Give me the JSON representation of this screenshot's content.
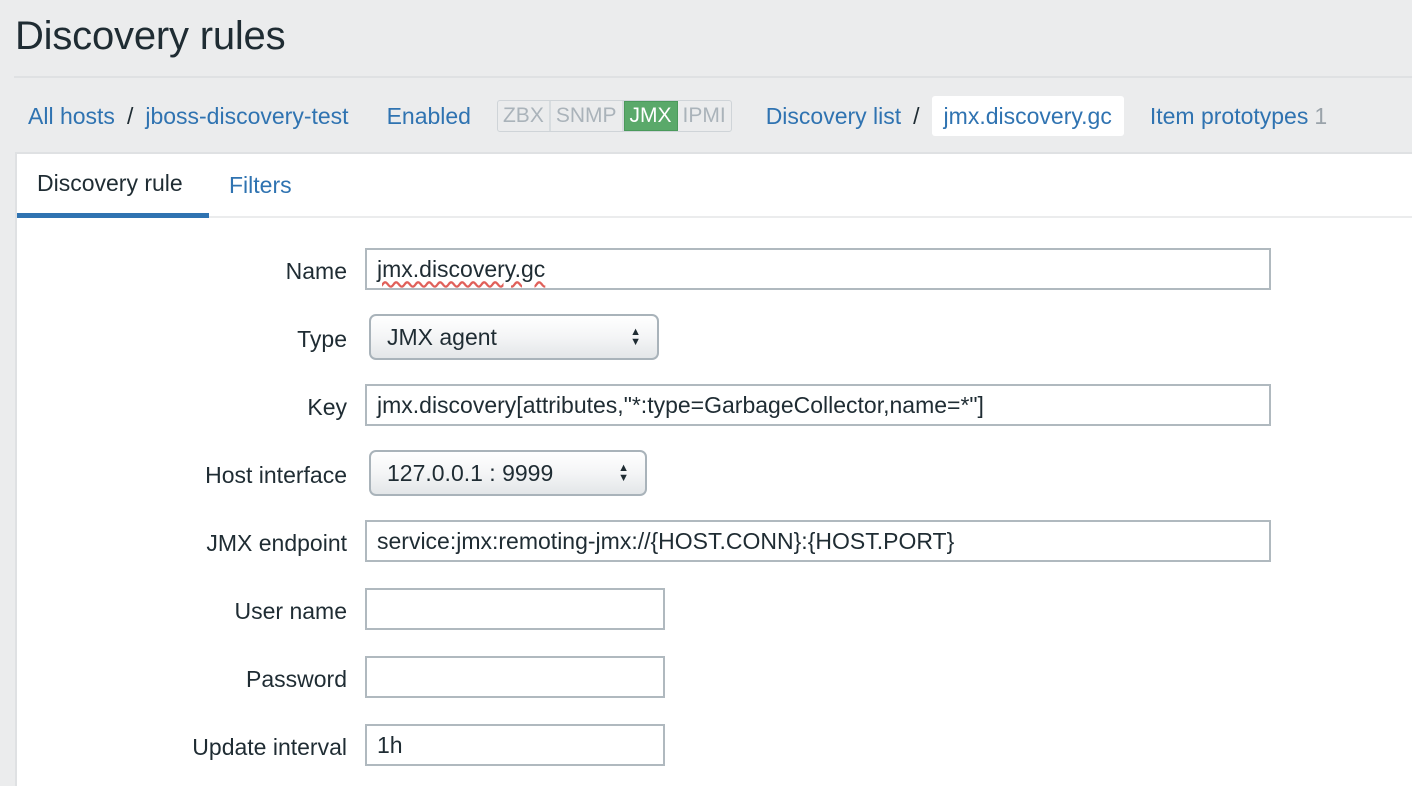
{
  "page": {
    "title": "Discovery rules"
  },
  "nav": {
    "all_hosts": "All hosts",
    "separator": "/",
    "host": "jboss-discovery-test",
    "status": "Enabled",
    "availability": [
      {
        "label": "ZBX",
        "active": false
      },
      {
        "label": "SNMP",
        "active": false
      },
      {
        "label": "JMX",
        "active": true
      },
      {
        "label": "IPMI",
        "active": false
      }
    ],
    "discovery_list": "Discovery list",
    "current_rule": "jmx.discovery.gc",
    "item_prototypes": "Item prototypes",
    "item_prototypes_count": "1"
  },
  "tabs": {
    "discovery_rule": "Discovery rule",
    "filters": "Filters"
  },
  "form": {
    "name": {
      "label": "Name",
      "value": "jmx.discovery.gc"
    },
    "type": {
      "label": "Type",
      "value": "JMX agent"
    },
    "key": {
      "label": "Key",
      "value": "jmx.discovery[attributes,\"*:type=GarbageCollector,name=*\"]"
    },
    "host_interface": {
      "label": "Host interface",
      "value": "127.0.0.1 : 9999"
    },
    "jmx_endpoint": {
      "label": "JMX endpoint",
      "value": "service:jmx:remoting-jmx://{HOST.CONN}:{HOST.PORT}"
    },
    "user_name": {
      "label": "User name",
      "value": ""
    },
    "password": {
      "label": "Password",
      "value": ""
    },
    "update_interval": {
      "label": "Update interval",
      "value": "1h"
    }
  },
  "colors": {
    "link": "#2f73b1",
    "enabled": "#4f9e4f",
    "jmx_active": "#5aa96a",
    "tab_underline": "#2f73b1"
  }
}
